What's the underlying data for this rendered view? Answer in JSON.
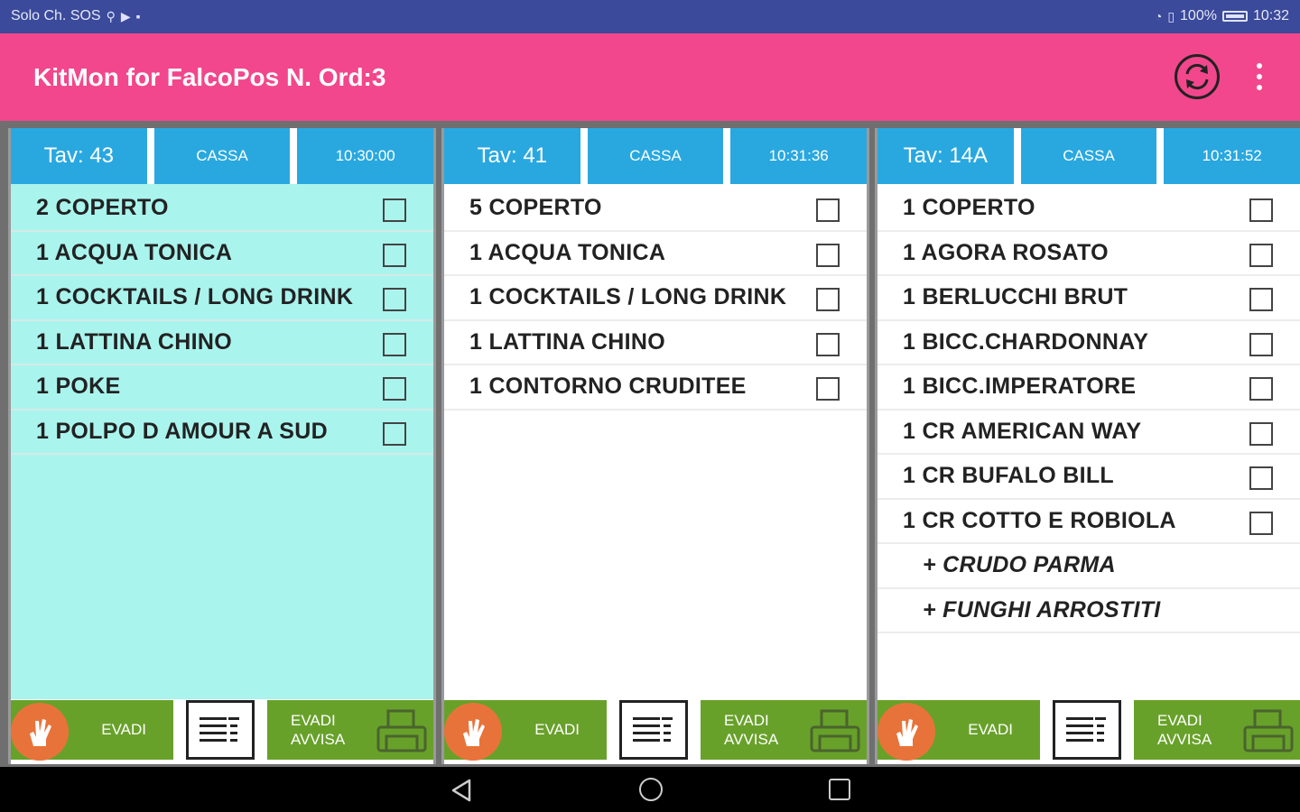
{
  "status_bar": {
    "left_text": "Solo Ch. SOS",
    "battery": "100%",
    "time": "10:32"
  },
  "app_bar": {
    "title": "KitMon for FalcoPos N. Ord:3",
    "sync_icon": "sync-icon",
    "menu_icon": "overflow-menu-icon",
    "accent_color": "#f2478c"
  },
  "colors": {
    "header_blue": "#29a8e0",
    "button_green": "#68a12a",
    "highlight_cyan": "#aaf4ee",
    "evadi_circle": "#e8733a"
  },
  "orders": [
    {
      "tav": "Tav: 43",
      "source": "CASSA",
      "time": "10:30:00",
      "highlighted": true,
      "items": [
        {
          "label": "2 COPERTO",
          "checkbox": true
        },
        {
          "label": "1 ACQUA TONICA",
          "checkbox": true
        },
        {
          "label": "1 COCKTAILS / LONG DRINK",
          "checkbox": true
        },
        {
          "label": "1 LATTINA CHINO",
          "checkbox": true
        },
        {
          "label": "1 POKE",
          "checkbox": true
        },
        {
          "label": "1 POLPO D AMOUR A SUD",
          "checkbox": true
        }
      ],
      "evadi_label": "EVADI",
      "evadi_avvisa_line1": "EVADI",
      "evadi_avvisa_line2": "AVVISA"
    },
    {
      "tav": "Tav: 41",
      "source": "CASSA",
      "time": "10:31:36",
      "highlighted": false,
      "items": [
        {
          "label": "5 COPERTO",
          "checkbox": true
        },
        {
          "label": "1 ACQUA TONICA",
          "checkbox": true
        },
        {
          "label": "1 COCKTAILS / LONG DRINK",
          "checkbox": true
        },
        {
          "label": "1 LATTINA CHINO",
          "checkbox": true
        },
        {
          "label": "1 CONTORNO CRUDITEE",
          "checkbox": true
        }
      ],
      "evadi_label": "EVADI",
      "evadi_avvisa_line1": "EVADI",
      "evadi_avvisa_line2": "AVVISA"
    },
    {
      "tav": "Tav: 14A",
      "source": "CASSA",
      "time": "10:31:52",
      "highlighted": false,
      "items": [
        {
          "label": "1 COPERTO",
          "checkbox": true
        },
        {
          "label": "1 AGORA ROSATO",
          "checkbox": true
        },
        {
          "label": "1 BERLUCCHI BRUT",
          "checkbox": true
        },
        {
          "label": "1 BICC.CHARDONNAY",
          "checkbox": true
        },
        {
          "label": "1 BICC.IMPERATORE",
          "checkbox": true
        },
        {
          "label": "1 CR AMERICAN WAY",
          "checkbox": true
        },
        {
          "label": "1 CR BUFALO BILL",
          "checkbox": true
        },
        {
          "label": "1 CR COTTO E ROBIOLA",
          "checkbox": true
        },
        {
          "label": "+ CRUDO PARMA",
          "checkbox": false,
          "modifier": true
        },
        {
          "label": "+ FUNGHI ARROSTITI",
          "checkbox": false,
          "modifier": true
        }
      ],
      "evadi_label": "EVADI",
      "evadi_avvisa_line1": "EVADI",
      "evadi_avvisa_line2": "AVVISA"
    }
  ],
  "nav_bar": {
    "back_icon": "back-icon",
    "home_icon": "home-icon",
    "recents_icon": "recents-icon"
  }
}
